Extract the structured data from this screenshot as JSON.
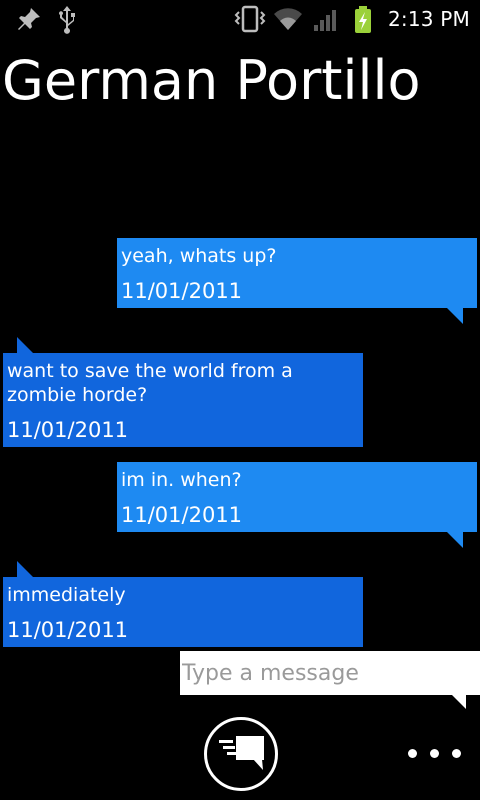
{
  "status_bar": {
    "time": "2:13 PM",
    "icons": [
      "pin-icon",
      "usb-icon",
      "vibrate-icon",
      "wifi-icon",
      "signal-icon",
      "battery-charging-icon"
    ]
  },
  "conversation": {
    "contact_name": "German Portillo",
    "messages": [
      {
        "direction": "outgoing",
        "text": "yeah, whats up?",
        "date": "11/01/2011"
      },
      {
        "direction": "incoming",
        "text": "want to save the world from a zombie horde?",
        "date": "11/01/2011"
      },
      {
        "direction": "outgoing",
        "text": "im in. when?",
        "date": "11/01/2011"
      },
      {
        "direction": "incoming",
        "text": "immediately",
        "date": "11/01/2011"
      }
    ]
  },
  "compose": {
    "placeholder": "Type a message",
    "value": ""
  },
  "actions": {
    "send_icon": "send-message-icon",
    "overflow_icon": "overflow-menu-icon"
  },
  "colors": {
    "outgoing_bubble": "#1e8af2",
    "incoming_bubble": "#1166dd",
    "background": "#000000"
  }
}
